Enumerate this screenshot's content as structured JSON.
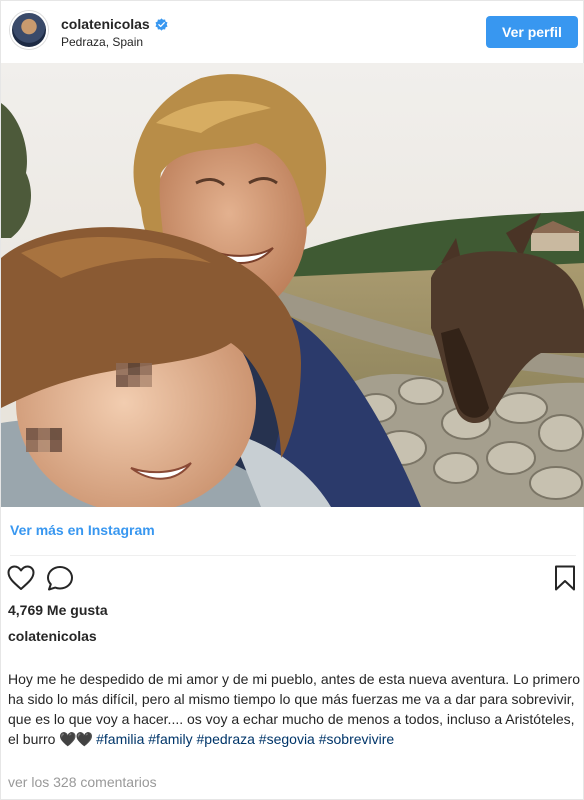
{
  "header": {
    "username": "colatenicolas",
    "location": "Pedraza, Spain",
    "profile_button": "Ver perfil",
    "verified_icon": "verified-badge-icon",
    "accent_color": "#3897f0"
  },
  "photo": {
    "icon": "selfie-photo"
  },
  "insta_link": "Ver más en Instagram",
  "actions": {
    "like_icon": "heart-icon",
    "comment_icon": "comment-icon",
    "save_icon": "bookmark-icon"
  },
  "likes": "4,769 Me gusta",
  "caption": {
    "username": "colatenicolas",
    "text": "Hoy me he despedido de mi amor y de mi pueblo, antes de esta nueva aventura. Lo primero ha sido lo más difícil, pero al mismo tiempo lo que más fuerzas me va a dar para sobrevivir, que es lo que voy a hacer.... os voy a echar mucho de menos a todos, incluso a Aristóteles, el burro",
    "hearts": "🖤🖤",
    "hashtags": [
      "#familia",
      "#family",
      "#pedraza",
      "#segovia",
      "#sobrevivire"
    ],
    "hashtag_color": "#003569"
  },
  "comments_link": "ver los 328 comentarios"
}
